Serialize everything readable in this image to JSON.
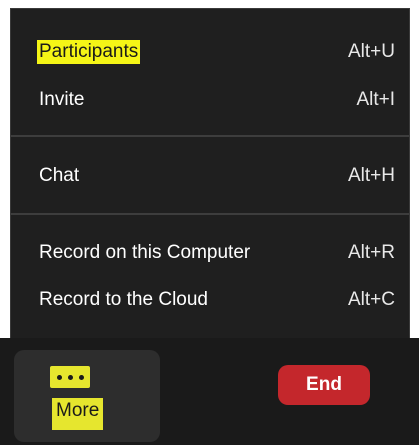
{
  "menu": {
    "items": [
      {
        "label": "Participants",
        "shortcut": "Alt+U"
      },
      {
        "label": "Invite",
        "shortcut": "Alt+I"
      },
      {
        "label": "Chat",
        "shortcut": "Alt+H"
      },
      {
        "label": "Record on this Computer",
        "shortcut": "Alt+R"
      },
      {
        "label": "Record to the Cloud",
        "shortcut": "Alt+C"
      }
    ]
  },
  "toolbar": {
    "more_label": "More",
    "more_icon": "ellipsis-icon",
    "end_label": "End"
  },
  "colors": {
    "menu_bg": "#1f1f1f",
    "highlight": "#f5f516",
    "end_button": "#c4272c"
  }
}
